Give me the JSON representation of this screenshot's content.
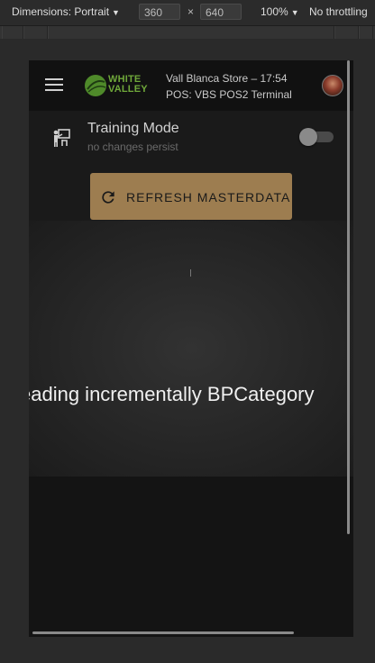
{
  "devtools": {
    "dimensions_label": "Dimensions: Portrait",
    "width_value": "360",
    "height_value": "640",
    "times": "×",
    "zoom": "100%",
    "throttling": "No throttling"
  },
  "toolbar": {
    "logo_line1": "WHITE",
    "logo_line2": "VALLEY",
    "store_line": "Vall Blanca Store – 17:54",
    "terminal_line": "POS: VBS POS2 Terminal"
  },
  "training": {
    "title": "Training Mode",
    "subtitle": "no changes persist",
    "enabled": false
  },
  "refresh_button": {
    "label": "REFRESH MASTERDATA"
  },
  "loading": {
    "message": "eading incrementally BPCategory"
  },
  "colors": {
    "accent_button": "#9d7d50",
    "logo_green": "#6fa83a"
  }
}
